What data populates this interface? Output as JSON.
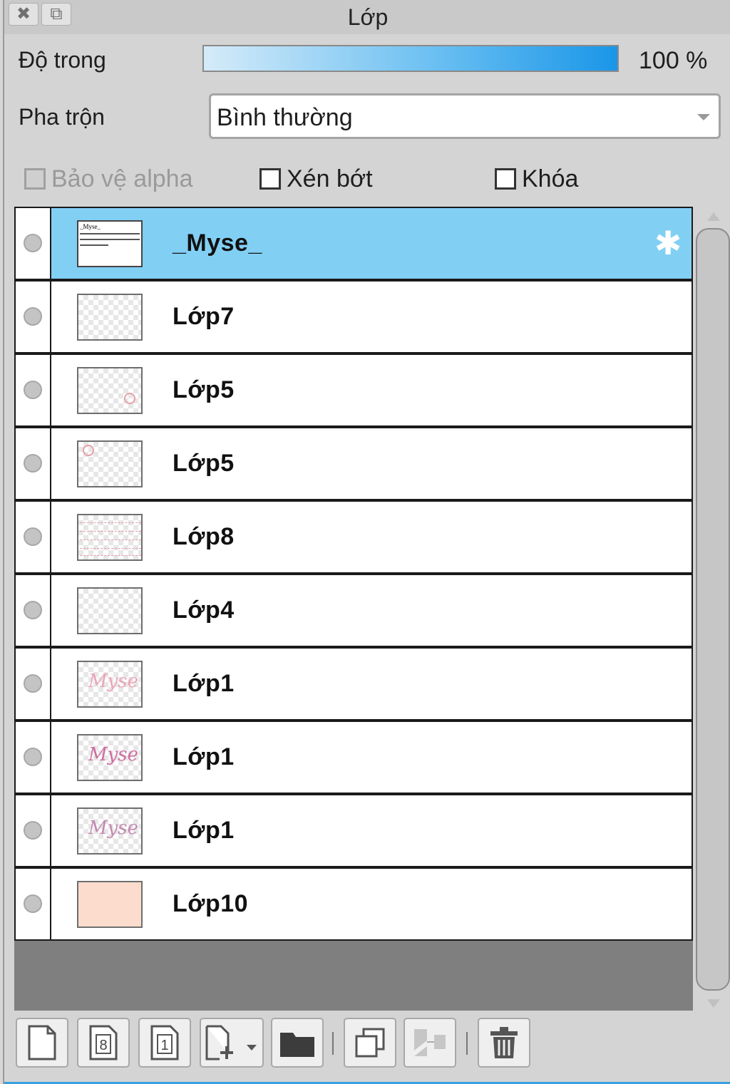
{
  "window": {
    "title": "Lớp",
    "close_icon": "✖",
    "popout_icon": "⧉"
  },
  "opacity": {
    "label": "Độ trong",
    "value": "100 %",
    "level_percent": 100
  },
  "blend": {
    "label": "Pha trộn",
    "selected": "Bình thường"
  },
  "options": {
    "protect_alpha": "Bảo vệ alpha",
    "clip": "Xén bớt",
    "lock": "Khóa"
  },
  "layers": [
    {
      "name": "_Myse_",
      "thumb": "text",
      "selected": true
    },
    {
      "name": "Lớp7",
      "thumb": "transparent"
    },
    {
      "name": "Lớp5",
      "thumb": "transparent-mark"
    },
    {
      "name": "Lớp5",
      "thumb": "transparent-mark"
    },
    {
      "name": "Lớp8",
      "thumb": "pink-lines"
    },
    {
      "name": "Lớp4",
      "thumb": "transparent"
    },
    {
      "name": "Lớp1",
      "thumb": "script",
      "script_text": "Myse"
    },
    {
      "name": "Lớp1",
      "thumb": "script",
      "script_text": "Myse"
    },
    {
      "name": "Lớp1",
      "thumb": "script",
      "script_text": "Myse"
    },
    {
      "name": "Lớp10",
      "thumb": "solid"
    }
  ],
  "thumb_text": "_Myse_",
  "colors": {
    "selected_row": "#82cff4",
    "solid_thumb": "#fbdccd",
    "script_thumb": "#d98aa8"
  },
  "toolbar": {
    "icons": [
      "new-raster-layer-icon",
      "new-8bit-layer-icon",
      "new-1bit-layer-icon",
      "new-layer-menu-icon",
      "new-folder-icon",
      "duplicate-layer-icon",
      "merge-layer-icon",
      "delete-layer-icon"
    ],
    "num_8": "8",
    "num_1": "1"
  }
}
